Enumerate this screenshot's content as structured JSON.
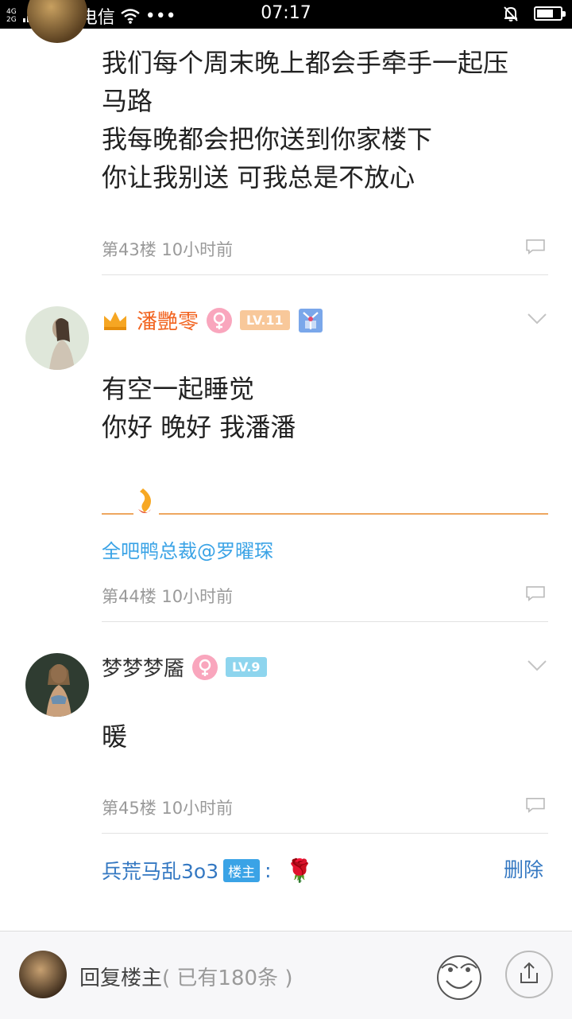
{
  "status_bar": {
    "net_top": "4G",
    "net_bottom": "2G",
    "carrier": "中国电信",
    "dots": "•••",
    "time": "07:17",
    "battery_level_percent": 70
  },
  "posts": [
    {
      "lines": [
        "我们每个周末晚上都会手牵手一起压",
        "马路",
        "我每晚都会把你送到你家楼下",
        "你让我别送 可我总是不放心"
      ],
      "meta": "第43楼  10小时前"
    },
    {
      "username": "潘艷零",
      "level": "LV.11",
      "lines": [
        "有空一起睡觉",
        "你好 晚好 我潘潘"
      ],
      "signature": "全吧鸭总裁@罗曜琛",
      "meta": "第44楼  10小时前"
    },
    {
      "username": "梦梦梦靥",
      "level": "LV.9",
      "lines": [
        "暖"
      ],
      "meta": "第45楼  10小时前",
      "reply": {
        "user": "兵荒马乱3o3",
        "tag": "楼主",
        "colon": ":",
        "emoji": "🌹",
        "delete_label": "删除"
      }
    }
  ],
  "bottom_bar": {
    "reply_label": "回复楼主",
    "count_text": "( 已有180条 )"
  },
  "colors": {
    "link_blue": "#3aa3e6",
    "vip_name": "#f26522",
    "level_orange": "#f8c89a",
    "level_blue": "#8ed5ee"
  }
}
